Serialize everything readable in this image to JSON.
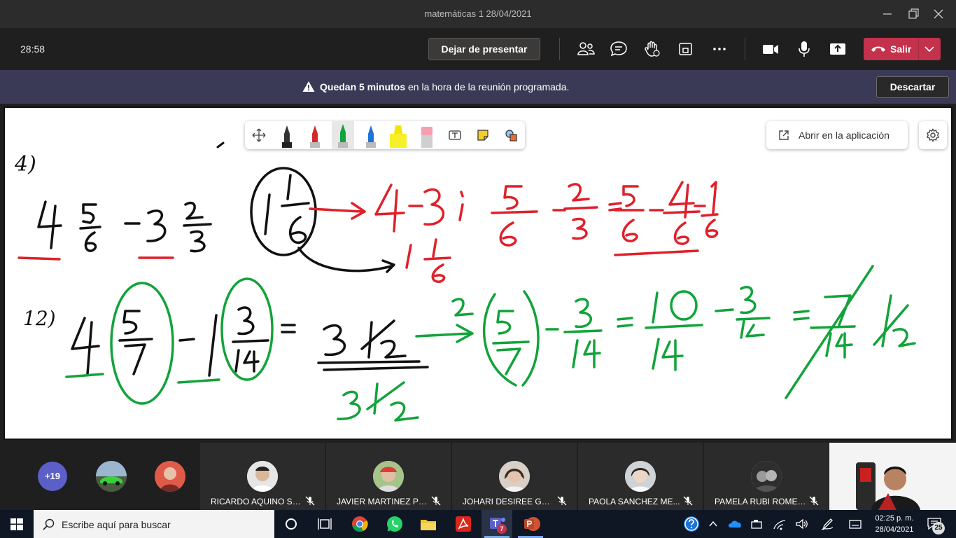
{
  "window": {
    "title": "matemáticas 1 28/04/2021"
  },
  "meeting": {
    "timer": "28:58",
    "stop_presenting_label": "Dejar de presentar",
    "leave_label": "Salir"
  },
  "notice": {
    "bold_text": "Quedan 5 minutos",
    "rest_text": " en la hora de la reunión programada.",
    "dismiss_label": "Descartar"
  },
  "whiteboard": {
    "open_in_app_label": "Abrir en la aplicación",
    "handwriting": {
      "problem_a_number": "4)",
      "problem_b_number": "12)"
    }
  },
  "participants": {
    "overflow_count": "+19",
    "tiles": [
      {
        "name": "RICARDO AQUINO SA..."
      },
      {
        "name": "JAVIER MARTINEZ PIÑA"
      },
      {
        "name": "JOHARI DESIREE GUIL..."
      },
      {
        "name": "PAOLA SANCHEZ ME..."
      },
      {
        "name": "PAMELA RUBI ROMER..."
      }
    ]
  },
  "taskbar": {
    "search_placeholder": "Escribe aquí para buscar",
    "teams_badge": "7",
    "time": "02:25 p. m.",
    "date": "28/04/2021",
    "notification_count": "25"
  },
  "colors": {
    "leave_red": "#c4314b",
    "notice_bg": "#3a3a56",
    "ink_red": "#e0202a",
    "ink_green": "#12a33a",
    "ink_black": "#111111",
    "teams_purple": "#5b5fc7"
  }
}
